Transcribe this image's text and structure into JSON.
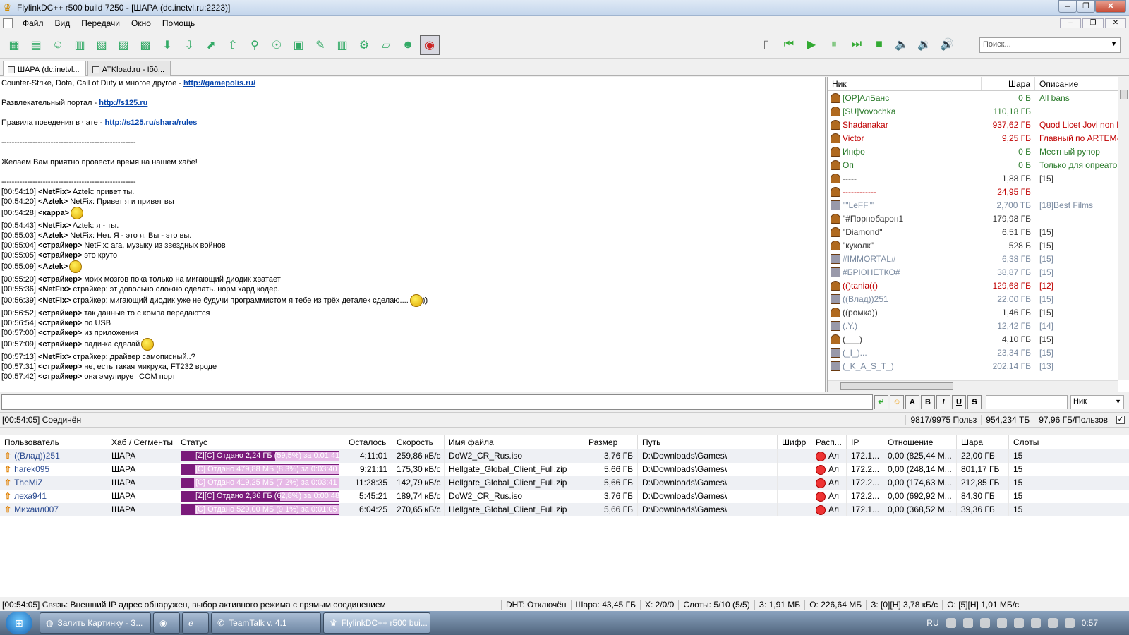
{
  "window": {
    "title": "FlylinkDC++ r500 build 7250 - [ШАРА (dc.inetvl.ru:2223)]",
    "min": "–",
    "max": "❐",
    "close": "✕"
  },
  "menu": [
    "Файл",
    "Вид",
    "Передачи",
    "Окно",
    "Помощь"
  ],
  "search": {
    "placeholder": "Поиск..."
  },
  "tabs": [
    {
      "label": "ШАРА (dc.inetvl...",
      "active": true
    },
    {
      "label": "ATKload.ru - Іõõ...",
      "active": false
    }
  ],
  "chat": {
    "lines": [
      {
        "pre": "Counter-Strike, Dota, Call of Duty и многое другое - ",
        "link": "http://gamepolis.ru/"
      },
      {
        "pre": ""
      },
      {
        "pre": "Развлекательный портал - ",
        "link": "http://s125.ru"
      },
      {
        "pre": ""
      },
      {
        "pre": "Правила поведения в чате - ",
        "link": "http://s125.ru/shara/rules"
      },
      {
        "pre": ""
      },
      {
        "pre": "----------------------------------------------------"
      },
      {
        "pre": ""
      },
      {
        "pre": "Желаем Вам приятно провести время на нашем хабе!"
      },
      {
        "pre": ""
      },
      {
        "pre": "----------------------------------------------------"
      }
    ],
    "messages": [
      {
        "ts": "[00:54:10]",
        "nick": "<NetFix>",
        "text": " Aztek: привет ты."
      },
      {
        "ts": "[00:54:20]",
        "nick": "<Aztek>",
        "text": " NetFix: Привет я и привет вы"
      },
      {
        "ts": "[00:54:28]",
        "nick": "<карра>",
        "text": "",
        "smile": true
      },
      {
        "ts": "[00:54:43]",
        "nick": "<NetFix>",
        "text": " Aztek: я - ты."
      },
      {
        "ts": "[00:55:03]",
        "nick": "<Aztek>",
        "text": " NetFix: Нет. Я - это я. Вы - это вы."
      },
      {
        "ts": "[00:55:04]",
        "nick": "<страйкер>",
        "text": " NetFix: ага, музыку из звездных войнов"
      },
      {
        "ts": "[00:55:05]",
        "nick": "<страйкер>",
        "text": " это круто"
      },
      {
        "ts": "[00:55:09]",
        "nick": "<Aztek>",
        "text": "",
        "smile": true
      },
      {
        "ts": "[00:55:20]",
        "nick": "<страйкер>",
        "text": " моих мозгов пока только на мигающий диодик хватает"
      },
      {
        "ts": "[00:55:36]",
        "nick": "<NetFix>",
        "text": " страйкер: эт довольно сложно сделать. норм хард кодер."
      },
      {
        "ts": "[00:56:39]",
        "nick": "<NetFix>",
        "text": " страйкер: мигающий диодик уже не будучи программистом я тебе из трёх деталек сделаю....",
        "smile": true,
        "after": "))"
      },
      {
        "ts": "[00:56:52]",
        "nick": "<страйкер>",
        "text": " так данные то с компа передаются"
      },
      {
        "ts": "[00:56:54]",
        "nick": "<страйкер>",
        "text": " по USB"
      },
      {
        "ts": "[00:57:00]",
        "nick": "<страйкер>",
        "text": " из приложения"
      },
      {
        "ts": "[00:57:09]",
        "nick": "<страйкер>",
        "text": " пади-ка сделай",
        "smile": true
      },
      {
        "ts": "[00:57:13]",
        "nick": "<NetFix>",
        "text": " страйкер: драйвер самописный..?"
      },
      {
        "ts": "[00:57:31]",
        "nick": "<страйкер>",
        "text": " не, есть такая микруха, FT232 вроде"
      },
      {
        "ts": "[00:57:42]",
        "nick": "<страйкер>",
        "text": " она эмулирует COM порт"
      }
    ]
  },
  "userlist": {
    "headers": {
      "nick": "Ник",
      "share": "Шара",
      "desc": "Описание"
    },
    "users": [
      {
        "nick": "[OP]АлБанс",
        "share": "0 Б",
        "desc": "All bans",
        "color": "#2a7a2a"
      },
      {
        "nick": "[SU]Vovochka",
        "share": "110,18 ГБ",
        "desc": "",
        "color": "#2a7a2a"
      },
      {
        "nick": "Shadanakar",
        "share": "937,62 ГБ",
        "desc": "Quod Licet Jovi non l",
        "color": "#c00000"
      },
      {
        "nick": "Victor",
        "share": "9,25 ГБ",
        "desc": "Главный по ARTEM-",
        "color": "#c00000"
      },
      {
        "nick": "Инфо",
        "share": "0 Б",
        "desc": "Местный рупор",
        "color": "#2a7a2a"
      },
      {
        "nick": "Оп",
        "share": "0 Б",
        "desc": "Только для опреато",
        "color": "#2a7a2a"
      },
      {
        "nick": "-----",
        "share": "1,88 ГБ",
        "desc": "[15]",
        "color": "#333"
      },
      {
        "nick": "------------",
        "share": "24,95 ГБ",
        "desc": "",
        "color": "#c00000"
      },
      {
        "nick": "\"\"LeFF\"\"",
        "share": "2,700 ТБ",
        "desc": "[18]Best Films",
        "color": "#7a8aa0"
      },
      {
        "nick": "\"#Порнобарон1",
        "share": "179,98 ГБ",
        "desc": "",
        "color": "#333"
      },
      {
        "nick": "\"Diamond\"",
        "share": "6,51 ГБ",
        "desc": "[15]",
        "color": "#333"
      },
      {
        "nick": "\"куколк\"",
        "share": "528 Б",
        "desc": "[15]",
        "color": "#333"
      },
      {
        "nick": "#IMMORTAL#",
        "share": "6,38 ГБ",
        "desc": "[15]",
        "color": "#7a8aa0"
      },
      {
        "nick": "#БРЮНЕТКО#",
        "share": "38,87 ГБ",
        "desc": "[15]",
        "color": "#7a8aa0"
      },
      {
        "nick": "(()tania(()",
        "share": "129,68 ГБ",
        "desc": "[12]",
        "color": "#c00000"
      },
      {
        "nick": "((Влад))251",
        "share": "22,00 ГБ",
        "desc": "[15]",
        "color": "#7a8aa0"
      },
      {
        "nick": "((ромка))",
        "share": "1,46 ГБ",
        "desc": "[15]",
        "color": "#333"
      },
      {
        "nick": "(.Y.)",
        "share": "12,42 ГБ",
        "desc": "[14]",
        "color": "#7a8aa0"
      },
      {
        "nick": "(___)",
        "share": "4,10 ГБ",
        "desc": "[15]",
        "color": "#333"
      },
      {
        "nick": "(_I_)...",
        "share": "23,34 ГБ",
        "desc": "[15]",
        "color": "#7a8aa0"
      },
      {
        "nick": "(_K_A_S_T_)",
        "share": "202,14 ГБ",
        "desc": "[13]",
        "color": "#7a8aa0"
      }
    ]
  },
  "input": {
    "nick_select": "Ник"
  },
  "status_top": {
    "left": "[00:54:05] Соединён",
    "users": "9817/9975 Польз",
    "share": "954,234 ТБ",
    "avg": "97,96 ГБ/Пользов"
  },
  "transfers": {
    "headers": [
      "Пользователь",
      "Хаб / Сегменты",
      "Статус",
      "Осталось",
      "Скорость",
      "Имя файла",
      "Размер",
      "Путь",
      "Шифр",
      "Расп...",
      "IP",
      "Отношение",
      "Шара",
      "Слоты"
    ],
    "rows": [
      {
        "user": "((Влад))251",
        "hub": "ШАРА",
        "status": "[Z][C] Отдано 2,24 ГБ (59,5%) за 0:01:41",
        "progress": 0.595,
        "left": "4:11:01",
        "speed": "259,86 кБ/с",
        "file": "DoW2_CR_Rus.iso",
        "size": "3,76 ГБ",
        "path": "D:\\Downloads\\Games\\",
        "cipher": "",
        "client": "Ал",
        "ip": "172.1...",
        "ratio": "0,00 (825,44 М...",
        "share": "22,00 ГБ",
        "slots": "15"
      },
      {
        "user": "harek095",
        "hub": "ШАРА",
        "status": "[C] Отдано 479,88 МБ (8,3%) за 0:03:40",
        "progress": 0.083,
        "left": "9:21:11",
        "speed": "175,30 кБ/с",
        "file": "Hellgate_Global_Client_Full.zip",
        "size": "5,66 ГБ",
        "path": "D:\\Downloads\\Games\\",
        "cipher": "",
        "client": "Ал",
        "ip": "172.2...",
        "ratio": "0,00 (248,14 М...",
        "share": "801,17 ГБ",
        "slots": "15"
      },
      {
        "user": "TheMiZ",
        "hub": "ШАРА",
        "status": "[C] Отдано 419,25 МБ (7,2%) за 0:03:41",
        "progress": 0.072,
        "left": "11:28:35",
        "speed": "142,79 кБ/с",
        "file": "Hellgate_Global_Client_Full.zip",
        "size": "5,66 ГБ",
        "path": "D:\\Downloads\\Games\\",
        "cipher": "",
        "client": "Ал",
        "ip": "172.2...",
        "ratio": "0,00 (174,63 М...",
        "share": "212,85 ГБ",
        "slots": "15"
      },
      {
        "user": "леха941",
        "hub": "ШАРА",
        "status": "[Z][C] Отдано 2,36 ГБ (62,8%) за 0:00:48",
        "progress": 0.628,
        "left": "5:45:21",
        "speed": "189,74 кБ/с",
        "file": "DoW2_CR_Rus.iso",
        "size": "3,76 ГБ",
        "path": "D:\\Downloads\\Games\\",
        "cipher": "",
        "client": "Ал",
        "ip": "172.2...",
        "ratio": "0,00 (692,92 М...",
        "share": "84,30 ГБ",
        "slots": "15"
      },
      {
        "user": "Михаил007",
        "hub": "ШАРА",
        "status": "[C] Отдано 529,00 МБ (9,1%) за 0:01:05",
        "progress": 0.091,
        "left": "6:04:25",
        "speed": "270,65 кБ/с",
        "file": "Hellgate_Global_Client_Full.zip",
        "size": "5,66 ГБ",
        "path": "D:\\Downloads\\Games\\",
        "cipher": "",
        "client": "Ал",
        "ip": "172.1...",
        "ratio": "0,00 (368,52 М...",
        "share": "39,36 ГБ",
        "slots": "15"
      }
    ]
  },
  "status_bottom": {
    "main": "[00:54:05] Связь: Внешний IP адрес обнаружен, выбор активного режима с прямым соединением",
    "dht": "DHT: Отключён",
    "share": "Шара: 43,45 ГБ",
    "x": "X: 2/0/0",
    "slots": "Слоты: 5/10 (5/5)",
    "d": "З: 1,91 МБ",
    "o": "О: 226,64 МБ",
    "dl": "З: [0][Н] 3,78 кБ/с",
    "ul": "О: [5][Н] 1,01 МБ/с"
  },
  "taskbar": {
    "tasks": [
      {
        "label": "Залить Картинку - З...",
        "active": false
      },
      {
        "label": "",
        "active": false
      },
      {
        "label": "",
        "active": false
      },
      {
        "label": "TeamTalk v. 4.1",
        "active": false
      },
      {
        "label": "FlylinkDC++ r500 bui...",
        "active": true
      }
    ],
    "lang": "RU",
    "clock": "0:57"
  }
}
